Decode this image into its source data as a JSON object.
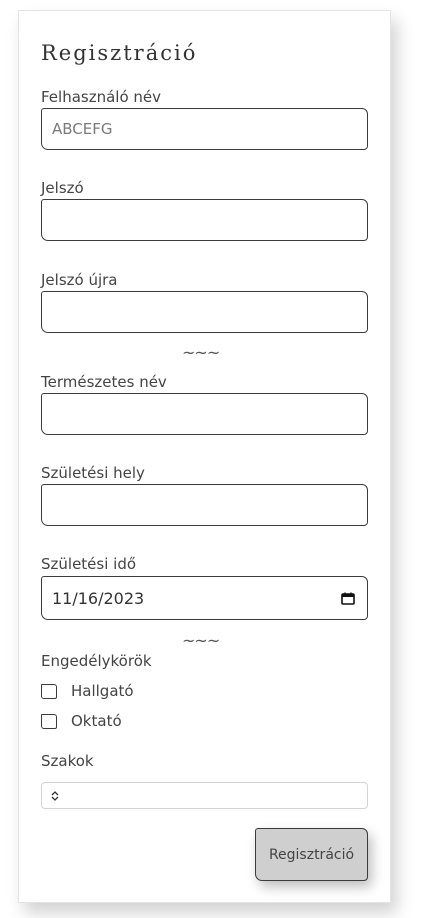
{
  "form": {
    "title": "Regisztráció",
    "username_label": "Felhasználó név",
    "username_value": "ABCEFG",
    "password_label": "Jelszó",
    "password_value": "",
    "password_again_label": "Jelszó újra",
    "password_again_value": "",
    "separator": "~~~",
    "natural_name_label": "Természetes név",
    "natural_name_value": "",
    "birth_place_label": "Születési hely",
    "birth_place_value": "",
    "birth_date_label": "Születési idő",
    "birth_date_value": "11/16/2023",
    "permissions_label": "Engedélykörök",
    "permissions": [
      {
        "label": "Hallgató",
        "checked": false
      },
      {
        "label": "Oktató",
        "checked": false
      }
    ],
    "majors_label": "Szakok",
    "majors_selected": "",
    "submit_label": "Regisztráció"
  },
  "icons": {
    "calendar": "calendar-icon",
    "select_arrows": "updown-chevron-icon"
  }
}
